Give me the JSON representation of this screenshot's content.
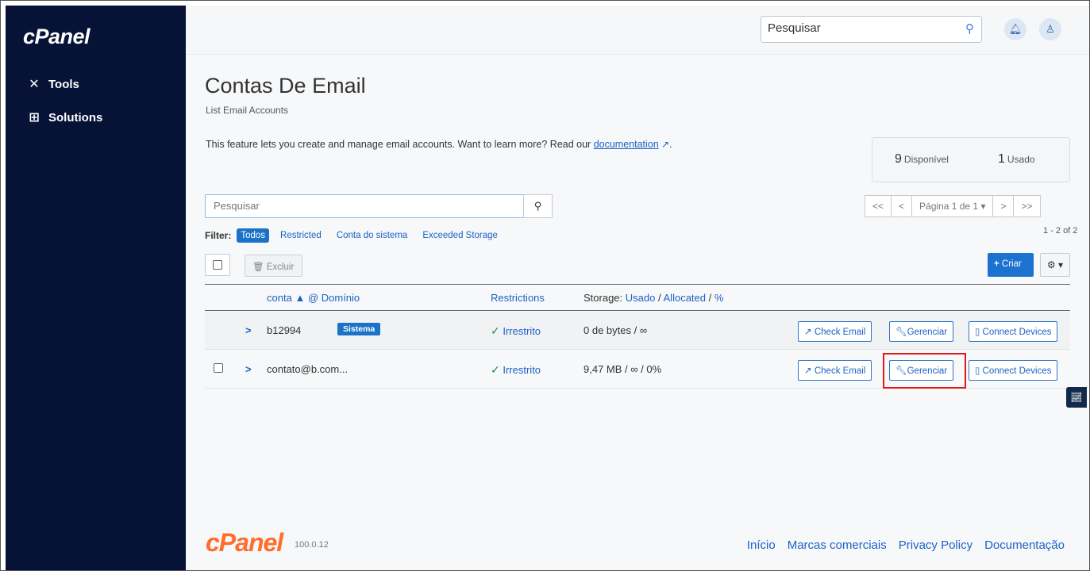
{
  "sidebar": {
    "brand": "cPanel",
    "items": [
      {
        "label": "Tools",
        "icon": "tools-icon"
      },
      {
        "label": "Solutions",
        "icon": "solutions-icon"
      }
    ]
  },
  "topbar": {
    "search_placeholder": "Pesquisar"
  },
  "page": {
    "title": "Contas De Email",
    "subtitle": "List Email Accounts",
    "intro_text": "This feature lets you create and manage email accounts. Want to learn more? Read our ",
    "intro_link": "documentation",
    "intro_tail": "."
  },
  "stats": {
    "available_value": "9",
    "available_label": "Disponível",
    "used_value": "1",
    "used_label": "Usado"
  },
  "list_search": {
    "placeholder": "Pesquisar"
  },
  "filter": {
    "label": "Filter:",
    "options": [
      "Todos",
      "Restricted",
      "Conta do sistema",
      "Exceeded Storage"
    ],
    "active": "Todos"
  },
  "pager": {
    "first": "<<",
    "prev": "<",
    "page_label": "Página 1 de 1",
    "next": ">",
    "last": ">>",
    "range": "1 - 2 of 2"
  },
  "toolbar": {
    "delete_label": "Excluir",
    "create_label": "Criar"
  },
  "table": {
    "col_account": "conta",
    "col_domain": "@ Domínio",
    "col_restrictions": "Restrictions",
    "col_storage_prefix": "Storage:",
    "col_storage_used": "Usado",
    "col_storage_allocated": "Allocated",
    "col_storage_pct": "%",
    "rows": [
      {
        "account": "b12994",
        "badge": "Sistema",
        "restriction": "Irrestrito",
        "storage": "0 de bytes / ∞",
        "check_email": "Check Email",
        "manage": "Gerenciar",
        "connect": "Connect Devices"
      },
      {
        "account": "contato@b.com...",
        "badge": "",
        "restriction": "Irrestrito",
        "storage": "9,47 MB / ∞ / 0%",
        "check_email": "Check Email",
        "manage": "Gerenciar",
        "connect": "Connect Devices"
      }
    ]
  },
  "footer": {
    "brand": "cPanel",
    "version": "100.0.12",
    "links": [
      "Início",
      "Marcas comerciais",
      "Privacy Policy",
      "Documentação"
    ]
  },
  "colors": {
    "sidebar_bg": "#061337",
    "accent": "#1a62c7",
    "highlight": "#e01818",
    "footer_logo": "#ff6c2c"
  }
}
